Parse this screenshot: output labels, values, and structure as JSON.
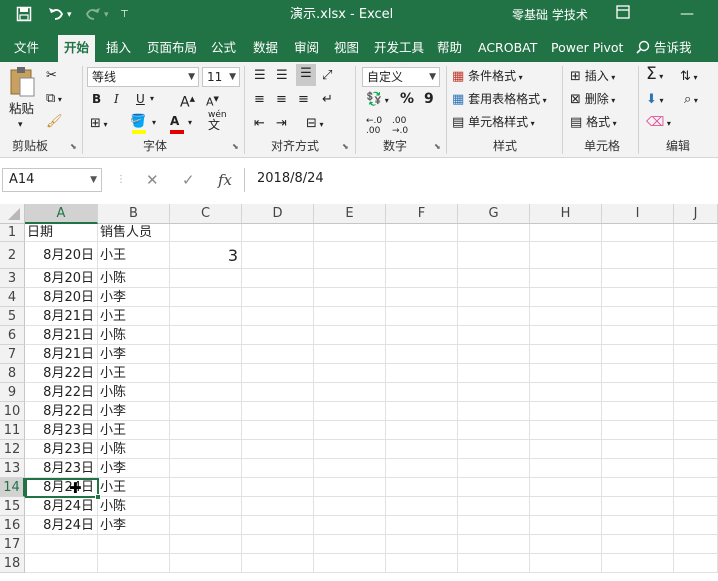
{
  "titlebar": {
    "save_icon": "save-icon",
    "undo_icon": "undo-icon",
    "redo_icon": "redo-icon",
    "customize_icon": "customize-icon",
    "title": "演示.xlsx  -  Excel",
    "brand": "零基础 学技术",
    "restore_icon": "ribbon-display-icon",
    "minimize_icon": "minimize-icon"
  },
  "tabs": [
    "文件",
    "开始",
    "插入",
    "页面布局",
    "公式",
    "数据",
    "审阅",
    "视图",
    "开发工具",
    "帮助",
    "ACROBAT",
    "Power Pivot"
  ],
  "tell_me": "告诉我",
  "ribbon": {
    "clipboard": {
      "paste": "粘贴",
      "label": "剪贴板"
    },
    "font": {
      "name": "等线",
      "size": "11",
      "label": "字体",
      "bold": "B",
      "italic": "I",
      "underline": "U",
      "grow": "A",
      "shrink": "A",
      "wen": "wén",
      "font_color": "A"
    },
    "alignment": {
      "label": "对齐方式"
    },
    "number": {
      "format": "自定义",
      "label": "数字",
      "percent": "%",
      "comma": "9",
      "inc": ".00",
      "dec": ".00"
    },
    "styles": {
      "conditional": "条件格式",
      "table": "套用表格格式",
      "cell": "单元格样式",
      "label": "样式"
    },
    "cells": {
      "insert": "插入",
      "delete": "删除",
      "format": "格式",
      "label": "单元格"
    },
    "editing": {
      "label": "编辑",
      "sum": "Σ"
    }
  },
  "formula_bar": {
    "name_box": "A14",
    "cancel": "✕",
    "confirm": "✓",
    "fx": "fx",
    "content": "2018/8/24"
  },
  "sheet": {
    "columns": [
      "A",
      "B",
      "C",
      "D",
      "E",
      "F",
      "G",
      "H",
      "I",
      "J"
    ],
    "rows": [
      "1",
      "2",
      "3",
      "4",
      "5",
      "6",
      "7",
      "8",
      "9",
      "10",
      "11",
      "12",
      "13",
      "14",
      "15",
      "16",
      "17",
      "18"
    ],
    "header_a": "日期",
    "header_b": "销售人员",
    "c2": "3",
    "dates": [
      "8月20日",
      "8月20日",
      "8月20日",
      "8月21日",
      "8月21日",
      "8月21日",
      "8月22日",
      "8月22日",
      "8月22日",
      "8月23日",
      "8月23日",
      "8月23日",
      "8月24日",
      "8月24日",
      "8月24日"
    ],
    "people": [
      "小王",
      "小陈",
      "小李",
      "小王",
      "小陈",
      "小李",
      "小王",
      "小陈",
      "小李",
      "小王",
      "小陈",
      "小李",
      "小王",
      "小陈",
      "小李"
    ]
  }
}
